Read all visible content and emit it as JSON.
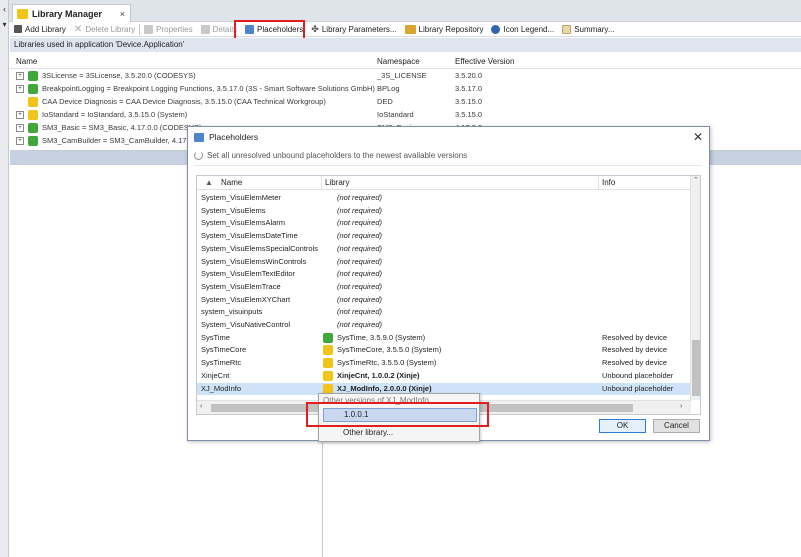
{
  "tab": {
    "title": "Library Manager",
    "close": "×"
  },
  "toolbar": {
    "add": "Add Library",
    "delete": "Delete Library",
    "properties": "Properties",
    "details": "Details",
    "placeholders": "Placeholders",
    "parameters": "Library Parameters...",
    "repository": "Library Repository",
    "legend": "Icon Legend...",
    "summary": "Summary..."
  },
  "app_caption": "Libraries used in application 'Device.Application'",
  "lib_table": {
    "headers": {
      "name": "Name",
      "namespace": "Namespace",
      "version": "Effective Version"
    },
    "rows": [
      {
        "name": "3SLicense = 3SLicense, 3.5.20.0 (CODESYS)",
        "namespace": "_3S_LICENSE",
        "version": "3.5.20.0",
        "icon": "green"
      },
      {
        "name": "BreakpointLogging = Breakpoint Logging Functions, 3.5.17.0 (3S - Smart Software Solutions GmbH)",
        "namespace": "BPLog",
        "version": "3.5.17.0",
        "icon": "green"
      },
      {
        "name": "CAA Device Diagnosis = CAA Device Diagnosis, 3.5.15.0 (CAA Technical Workgroup)",
        "namespace": "DED",
        "version": "3.5.15.0",
        "icon": "yellow"
      },
      {
        "name": "IoStandard = IoStandard, 3.5.15.0 (System)",
        "namespace": "IoStandard",
        "version": "3.5.15.0",
        "icon": "yellow"
      },
      {
        "name": "SM3_Basic = SM3_Basic, 4.17.0.0 (CODESYS)",
        "namespace": "SM3_Basic",
        "version": "4.17.0.0",
        "icon": "green"
      },
      {
        "name": "SM3_CamBuilder = SM3_CamBuilder, 4.17.0.0",
        "namespace": "",
        "version": "",
        "icon": "green"
      }
    ]
  },
  "dialog": {
    "title": "Placeholders",
    "set_label": "Set all unresolved unbound placeholders to the newest available versions",
    "headers": {
      "name": "Name",
      "library": "Library",
      "info": "Info"
    },
    "rows": [
      {
        "name": "System_VisuElemMeter",
        "library": "(not required)",
        "info": ""
      },
      {
        "name": "System_VisuElems",
        "library": "(not required)",
        "info": ""
      },
      {
        "name": "System_VisuElemsAlarm",
        "library": "(not required)",
        "info": ""
      },
      {
        "name": "System_VisuElemsDateTime",
        "library": "(not required)",
        "info": ""
      },
      {
        "name": "System_VisuElemsSpecialControls",
        "library": "(not required)",
        "info": ""
      },
      {
        "name": "System_VisuElemsWinControls",
        "library": "(not required)",
        "info": ""
      },
      {
        "name": "System_VisuElemTextEditor",
        "library": "(not required)",
        "info": ""
      },
      {
        "name": "System_VisuElemTrace",
        "library": "(not required)",
        "info": ""
      },
      {
        "name": "System_VisuElemXYChart",
        "library": "(not required)",
        "info": ""
      },
      {
        "name": "system_visuinputs",
        "library": "(not required)",
        "info": ""
      },
      {
        "name": "System_VisuNativeControl",
        "library": "(not required)",
        "info": ""
      },
      {
        "name": "SysTime",
        "library": "SysTime, 3.5.9.0 (System)",
        "info": "Resolved by device",
        "icon": "green"
      },
      {
        "name": "SysTimeCore",
        "library": "SysTimeCore, 3.5.5.0 (System)",
        "info": "Resolved by device",
        "icon": "yellow"
      },
      {
        "name": "SysTimeRtc",
        "library": "SysTimeRtc, 3.5.5.0 (System)",
        "info": "Resolved by device",
        "icon": "yellow"
      },
      {
        "name": "XinjeCnt",
        "library": "XinjeCnt, 1.0.0.2 (Xinje)",
        "info": "Unbound placeholder",
        "icon": "yellow",
        "bold": true
      },
      {
        "name": "XJ_ModInfo",
        "library": "XJ_ModInfo, 2.0.0.0 (Xinje)",
        "info": "Unbound placeholder",
        "icon": "yellow",
        "bold": true,
        "selected": true
      }
    ],
    "ok": "OK",
    "cancel": "Cancel"
  },
  "popup": {
    "header": "Other versions of XJ_ModInfo",
    "selected": "1.0.0.1",
    "other": "Other library..."
  },
  "colors": {
    "highlight": "#e02020",
    "selection": "#cfe3f8",
    "accent": "#2d7bd8"
  }
}
